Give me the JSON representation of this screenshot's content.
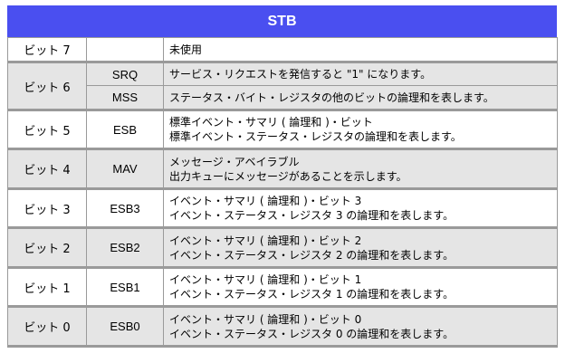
{
  "title": "STB",
  "rows": {
    "b7": {
      "bit": "ビット 7",
      "code": "",
      "desc": "未使用"
    },
    "b6a": {
      "bit": "ビット 6",
      "code": "SRQ",
      "desc": "サービス・リクエストを発信すると \"1\" になります。"
    },
    "b6b": {
      "code": "MSS",
      "desc": "ステータス・バイト・レジスタの他のビットの論理和を表します。"
    },
    "b5": {
      "bit": "ビット 5",
      "code": "ESB",
      "desc1": "標準イベント・サマリ ( 論理和 )・ビット",
      "desc2": "標準イベント・ステータス・レジスタの論理和を表します。"
    },
    "b4": {
      "bit": "ビット 4",
      "code": "MAV",
      "desc1": "メッセージ・アベイラブル",
      "desc2": "出力キューにメッセージがあることを示します。"
    },
    "b3": {
      "bit": "ビット 3",
      "code": "ESB3",
      "desc1": "イベント・サマリ ( 論理和 )・ビット 3",
      "desc2": "イベント・ステータス・レジスタ 3 の論理和を表します。"
    },
    "b2": {
      "bit": "ビット 2",
      "code": "ESB2",
      "desc1": "イベント・サマリ ( 論理和 )・ビット 2",
      "desc2": "イベント・ステータス・レジスタ 2 の論理和を表します。"
    },
    "b1": {
      "bit": "ビット 1",
      "code": "ESB1",
      "desc1": "イベント・サマリ ( 論理和 )・ビット 1",
      "desc2": "イベント・ステータス・レジスタ 1 の論理和を表します。"
    },
    "b0": {
      "bit": "ビット 0",
      "code": "ESB0",
      "desc1": "イベント・サマリ ( 論理和 )・ビット 0",
      "desc2": "イベント・ステータス・レジスタ 0 の論理和を表します。"
    }
  }
}
